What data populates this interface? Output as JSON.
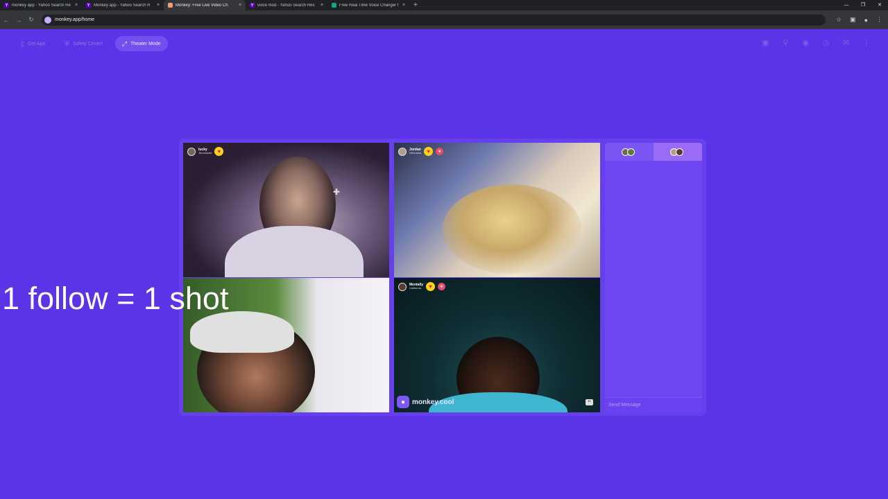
{
  "browser": {
    "tabs": [
      {
        "title": "monkey app - Yahoo Search Re",
        "favicon": "yahoo-icon",
        "active": false
      },
      {
        "title": "Monkey app - Yahoo Search R",
        "favicon": "yahoo-icon",
        "active": false
      },
      {
        "title": "Monkey: Free Live Video Ch",
        "favicon": "monkey-icon",
        "active": true
      },
      {
        "title": "voice mod - Yahoo Search Res",
        "favicon": "yahoo-icon",
        "active": false
      },
      {
        "title": "Free Real Time Voice Changer f",
        "favicon": "voice-icon",
        "active": false
      }
    ],
    "new_tab": "+",
    "close_glyph": "×",
    "url": "monkey.app/home"
  },
  "nav": {
    "get_app": "Get App",
    "safety_center": "Safety Center",
    "theater_mode": "Theater Mode"
  },
  "videos": [
    {
      "name": "lucky",
      "location": "Tennessee"
    },
    {
      "name": "Jordan",
      "location": "Nebraska"
    },
    {
      "name": "",
      "location": ""
    },
    {
      "name": "Mentally",
      "location": "California",
      "watermark": "monkey.cool"
    }
  ],
  "chat": {
    "placeholder": "Send Message"
  },
  "overlay": {
    "text": "1 follow = 1 shot"
  },
  "colors": {
    "page_bg": "#5a34e6",
    "panel_bg": "#6740ee",
    "accent": "#7150f0"
  }
}
